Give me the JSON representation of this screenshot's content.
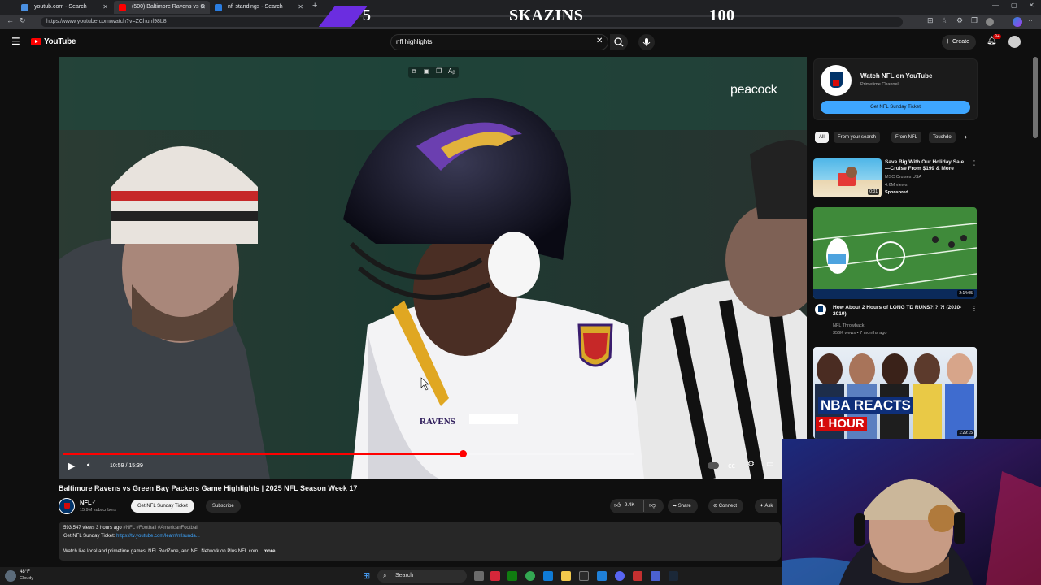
{
  "browser": {
    "tabs": [
      {
        "title": "youtub.com - Search"
      },
      {
        "title": "(500) Baltimore Ravens vs G"
      },
      {
        "title": "nfl standings - Search"
      }
    ],
    "url": "https://www.youtube.com/watch?v=ZChuhl98L8"
  },
  "overlay": {
    "left_score": "5",
    "name": "SKAZINS",
    "right_score": "100"
  },
  "youtube": {
    "logo": "YouTube",
    "search_value": "nfl highlights",
    "create_label": "Create",
    "notif_count": "9+"
  },
  "player": {
    "brand": "peacock",
    "time": "10:59 / 15:39",
    "progress": 0.7,
    "jersey": "RAVENS"
  },
  "video_info": {
    "title": "Baltimore Ravens vs Green Bay Packers Game Highlights | 2025 NFL Season Week 17",
    "channel": "NFL",
    "subs": "15.9M subscribers",
    "ticket_btn": "Get NFL Sunday Ticket",
    "subscribe": "Subscribe",
    "likes": "9.4K",
    "share": "Share",
    "connect": "Connect",
    "ask": "Ask",
    "desc_line1_stats": "593,547 views  3 hours ago",
    "desc_line1_tags": "#NFL #Football #AmericanFootball",
    "desc_line2_label": "Get NFL Sunday Ticket: ",
    "desc_line2_link": "https://tv.youtube.com/learn/nflsunda...",
    "desc_line3": "Watch live local and primetime games, NFL RedZone, and NFL Network on Plus.NFL.com",
    "more": "...more"
  },
  "sidebar": {
    "promo": {
      "title": "Watch NFL on YouTube",
      "subtitle": "Primetime Channel",
      "button": "Get NFL Sunday Ticket"
    },
    "chips": [
      "All",
      "From your search",
      "From NFL",
      "Touchdo"
    ],
    "videos": [
      {
        "title": "Save Big With Our Holiday Sale —Cruise From $199 & More",
        "channel": "MSC Cruises USA",
        "meta": "4.6M views",
        "badge": "Sponsored",
        "duration": "0:31"
      },
      {
        "title": "How About 2 Hours of LONG TD RUNS?!?!?! (2010-2019)",
        "channel": "NFL Throwback",
        "meta": "356K views • 7 months ago",
        "duration": "2:14:05"
      },
      {
        "title": "NBA REACTS",
        "subtitle": "1 HOUR",
        "duration": "1:29:15"
      }
    ]
  },
  "taskbar": {
    "weather_temp": "48°F",
    "weather_desc": "Cloudy",
    "search": "Search"
  }
}
